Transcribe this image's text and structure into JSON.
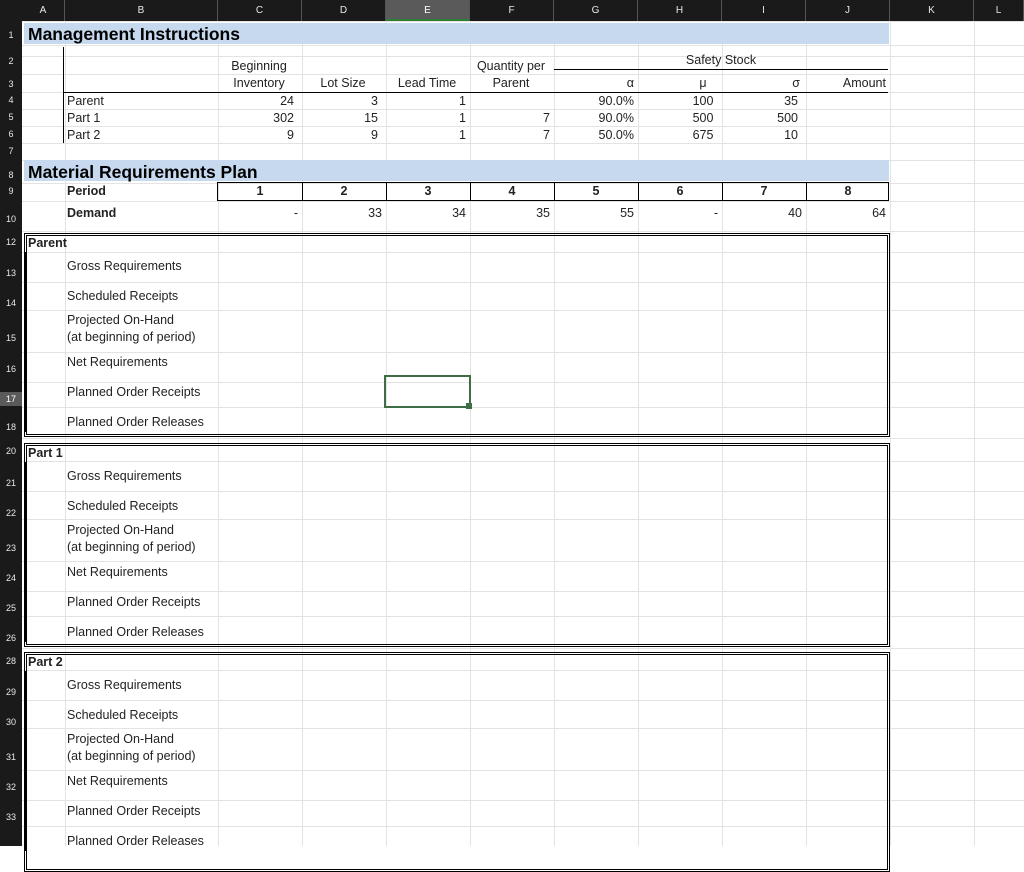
{
  "columns": [
    "A",
    "B",
    "C",
    "D",
    "E",
    "F",
    "G",
    "H",
    "I",
    "J",
    "K",
    "L"
  ],
  "selected_column": "E",
  "rows": [
    "1",
    "2",
    "3",
    "4",
    "5",
    "6",
    "7",
    "8",
    "9",
    "10",
    "12",
    "13",
    "14",
    "15",
    "16",
    "17",
    "18",
    "20",
    "21",
    "22",
    "23",
    "24",
    "25",
    "26",
    "28",
    "29",
    "30",
    "31",
    "32",
    "33"
  ],
  "selected_row": "17",
  "section1": {
    "title": "Management Instructions",
    "headers": {
      "beginning_inventory_1": "Beginning",
      "beginning_inventory_2": "Inventory",
      "lot_size": "Lot Size",
      "lead_time": "Lead Time",
      "qty_per_parent_1": "Quantity per",
      "qty_per_parent_2": "Parent",
      "safety_stock": "Safety Stock",
      "alpha": "α",
      "mu": "μ",
      "sigma": "σ",
      "amount": "Amount"
    },
    "items": [
      {
        "name": "Parent",
        "beg_inv": "24",
        "lot": "3",
        "lead": "1",
        "qty": "",
        "alpha": "90.0%",
        "mu": "100",
        "sigma": "35",
        "amount": ""
      },
      {
        "name": "Part 1",
        "beg_inv": "302",
        "lot": "15",
        "lead": "1",
        "qty": "7",
        "alpha": "90.0%",
        "mu": "500",
        "sigma": "500",
        "amount": ""
      },
      {
        "name": "Part 2",
        "beg_inv": "9",
        "lot": "9",
        "lead": "1",
        "qty": "7",
        "alpha": "50.0%",
        "mu": "675",
        "sigma": "10",
        "amount": ""
      }
    ]
  },
  "section2": {
    "title": "Material Requirements Plan",
    "period_label": "Period",
    "demand_label": "Demand",
    "periods": [
      "1",
      "2",
      "3",
      "4",
      "5",
      "6",
      "7",
      "8"
    ],
    "demand": [
      "-",
      "33",
      "34",
      "35",
      "55",
      "-",
      "40",
      "64"
    ]
  },
  "blocks": [
    {
      "name": "Parent"
    },
    {
      "name": "Part 1"
    },
    {
      "name": "Part 2"
    }
  ],
  "block_rows": {
    "gross": "Gross Requirements",
    "scheduled": "Scheduled Receipts",
    "projected_1": "Projected On-Hand",
    "projected_2": "(at beginning of period)",
    "net": "Net Requirements",
    "receipts": "Planned Order Receipts",
    "releases": "Planned Order Releases"
  }
}
